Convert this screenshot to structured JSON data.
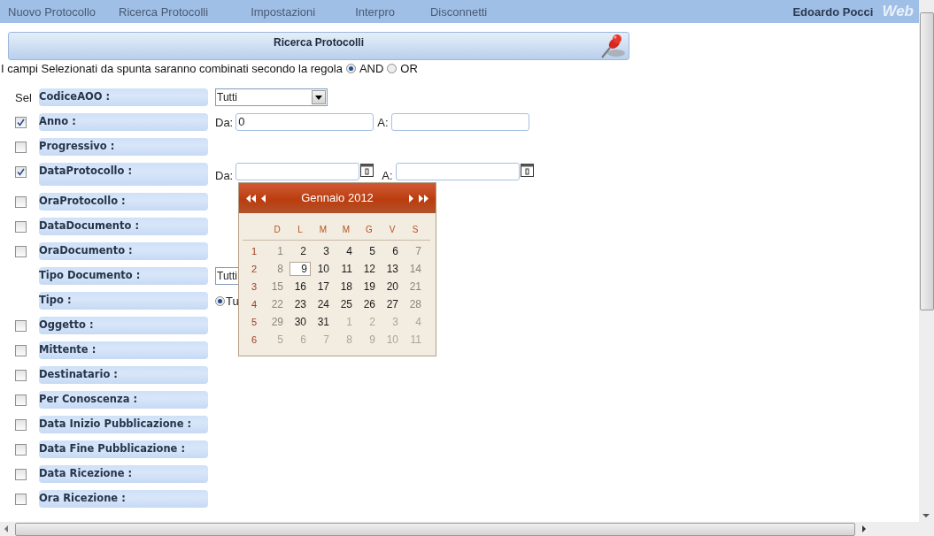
{
  "nav": {
    "items": [
      "Nuovo Protocollo",
      "Ricerca Protocolli",
      "Impostazioni",
      "Interpro",
      "Disconnetti"
    ],
    "user": "Edoardo Pocci",
    "logo": "Web"
  },
  "panel": {
    "title": "Ricerca Protocolli"
  },
  "rule": {
    "text": "I campi Selezionati da spunta saranno combinati secondo la regola",
    "options": [
      {
        "label": "AND",
        "selected": true
      },
      {
        "label": "OR",
        "selected": false
      }
    ]
  },
  "rows": [
    {
      "kind": "sel",
      "sel_label": "Sel",
      "label": "CodiceAOO :",
      "field": {
        "kind": "select",
        "value": "Tutti"
      }
    },
    {
      "kind": "checkbox",
      "checked": true,
      "label": "Anno :",
      "field": {
        "kind": "range",
        "from_label": "Da:",
        "from_value": "0",
        "to_label": "A:"
      }
    },
    {
      "kind": "checkbox",
      "checked": false,
      "label": "Progressivo :"
    },
    {
      "kind": "checkbox",
      "checked": true,
      "label": "DataProtocollo :",
      "field": {
        "kind": "date-range",
        "from_label": "Da:",
        "to_label": "A:"
      }
    },
    {
      "kind": "checkbox",
      "checked": false,
      "label": "OraProtocollo :"
    },
    {
      "kind": "checkbox",
      "checked": false,
      "label": "DataDocumento :"
    },
    {
      "kind": "checkbox",
      "checked": false,
      "label": "OraDocumento :"
    },
    {
      "kind": "none",
      "label": "Tipo Documento :",
      "field": {
        "kind": "select-cut",
        "value": "Tutti"
      }
    },
    {
      "kind": "none",
      "label": "Tipo :",
      "field": {
        "kind": "radio",
        "label": "Tu",
        "selected": true
      }
    },
    {
      "kind": "checkbox",
      "checked": false,
      "label": "Oggetto :"
    },
    {
      "kind": "checkbox",
      "checked": false,
      "label": "Mittente :"
    },
    {
      "kind": "checkbox",
      "checked": false,
      "label": "Destinatario :"
    },
    {
      "kind": "checkbox",
      "checked": false,
      "label": "Per Conoscenza :"
    },
    {
      "kind": "checkbox",
      "checked": false,
      "label": "Data Inizio Pubblicazione :"
    },
    {
      "kind": "checkbox",
      "checked": false,
      "label": "Data Fine Pubblicazione :"
    },
    {
      "kind": "checkbox",
      "checked": false,
      "label": "Data Ricezione :"
    },
    {
      "kind": "checkbox",
      "checked": false,
      "label": "Ora Ricezione :"
    }
  ],
  "calendar": {
    "title": "Gennaio 2012",
    "weekdays": [
      "D",
      "L",
      "M",
      "M",
      "G",
      "V",
      "S"
    ],
    "weeks": [
      {
        "number": "1",
        "days": [
          {
            "day": "1",
            "kind": "weekend",
            "selected": false
          },
          {
            "day": "2",
            "kind": "workday",
            "selected": false
          },
          {
            "day": "3",
            "kind": "workday",
            "selected": false
          },
          {
            "day": "4",
            "kind": "workday",
            "selected": false
          },
          {
            "day": "5",
            "kind": "workday",
            "selected": false
          },
          {
            "day": "6",
            "kind": "workday",
            "selected": false
          },
          {
            "day": "7",
            "kind": "weekend",
            "selected": false
          }
        ]
      },
      {
        "number": "2",
        "days": [
          {
            "day": "8",
            "kind": "weekend",
            "selected": false
          },
          {
            "day": "9",
            "kind": "workday",
            "selected": true
          },
          {
            "day": "10",
            "kind": "workday",
            "selected": false
          },
          {
            "day": "11",
            "kind": "workday",
            "selected": false
          },
          {
            "day": "12",
            "kind": "workday",
            "selected": false
          },
          {
            "day": "13",
            "kind": "workday",
            "selected": false
          },
          {
            "day": "14",
            "kind": "weekend",
            "selected": false
          }
        ]
      },
      {
        "number": "3",
        "days": [
          {
            "day": "15",
            "kind": "weekend",
            "selected": false
          },
          {
            "day": "16",
            "kind": "workday",
            "selected": false
          },
          {
            "day": "17",
            "kind": "workday",
            "selected": false
          },
          {
            "day": "18",
            "kind": "workday",
            "selected": false
          },
          {
            "day": "19",
            "kind": "workday",
            "selected": false
          },
          {
            "day": "20",
            "kind": "workday",
            "selected": false
          },
          {
            "day": "21",
            "kind": "weekend",
            "selected": false
          }
        ]
      },
      {
        "number": "4",
        "days": [
          {
            "day": "22",
            "kind": "weekend",
            "selected": false
          },
          {
            "day": "23",
            "kind": "workday",
            "selected": false
          },
          {
            "day": "24",
            "kind": "workday",
            "selected": false
          },
          {
            "day": "25",
            "kind": "workday",
            "selected": false
          },
          {
            "day": "26",
            "kind": "workday",
            "selected": false
          },
          {
            "day": "27",
            "kind": "workday",
            "selected": false
          },
          {
            "day": "28",
            "kind": "weekend",
            "selected": false
          }
        ]
      },
      {
        "number": "5",
        "days": [
          {
            "day": "29",
            "kind": "weekend",
            "selected": false
          },
          {
            "day": "30",
            "kind": "workday",
            "selected": false
          },
          {
            "day": "31",
            "kind": "workday",
            "selected": false
          },
          {
            "day": "1",
            "kind": "other",
            "selected": false
          },
          {
            "day": "2",
            "kind": "other",
            "selected": false
          },
          {
            "day": "3",
            "kind": "other",
            "selected": false
          },
          {
            "day": "4",
            "kind": "other",
            "selected": false
          }
        ]
      },
      {
        "number": "6",
        "days": [
          {
            "day": "5",
            "kind": "other",
            "selected": false
          },
          {
            "day": "6",
            "kind": "other",
            "selected": false
          },
          {
            "day": "7",
            "kind": "other",
            "selected": false
          },
          {
            "day": "8",
            "kind": "other",
            "selected": false
          },
          {
            "day": "9",
            "kind": "other",
            "selected": false
          },
          {
            "day": "10",
            "kind": "other",
            "selected": false
          },
          {
            "day": "11",
            "kind": "other",
            "selected": false
          }
        ]
      }
    ]
  }
}
